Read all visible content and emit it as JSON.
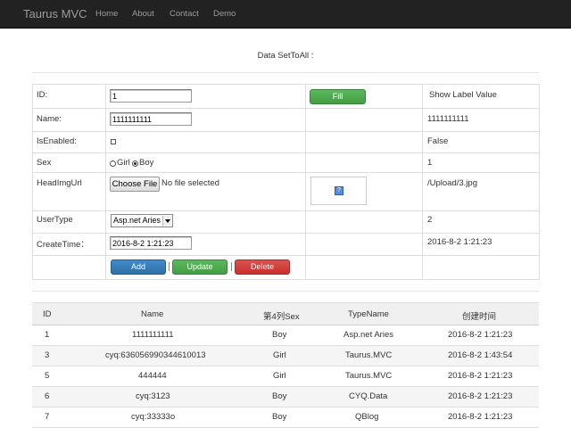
{
  "navbar": {
    "brand": "Taurus MVC",
    "links": [
      "Home",
      "About",
      "Contact",
      "Demo"
    ]
  },
  "form": {
    "title": "Data SetToAll :",
    "header_label": "Show Label Value",
    "fill_button": "Fill",
    "rows": {
      "id": {
        "label": "ID:",
        "input": "1"
      },
      "name": {
        "label": "Name:",
        "input": "1111111111",
        "value": "1111111111"
      },
      "enabled": {
        "label": "IsEnabled:",
        "value": "False"
      },
      "sex": {
        "label": "Sex",
        "option_girl": "Girl",
        "option_boy": "Boy",
        "value": "1"
      },
      "headimg": {
        "label": "HeadImgUrl",
        "file_button": "Choose File",
        "file_status": "No file selected",
        "value": "/Upload/3.jpg"
      },
      "usertype": {
        "label": "UserType",
        "selected": "Asp.net Aries",
        "value": "2"
      },
      "createtime": {
        "label": "CreateTime：",
        "input": "2016-8-2 1:21:23",
        "value": "2016-8-2 1:21:23"
      }
    },
    "actions": {
      "add": "Add",
      "update": "Update",
      "delete": "Delete"
    }
  },
  "table": {
    "headers": [
      "ID",
      "Name",
      "第4列Sex",
      "TypeName",
      "创建时间"
    ],
    "rows": [
      [
        "1",
        "1111111111",
        "Boy",
        "Asp.net Aries",
        "2016-8-2 1:21:23"
      ],
      [
        "3",
        "cyq:636056990344610013",
        "Girl",
        "Taurus.MVC",
        "2016-8-2 1:43:54"
      ],
      [
        "5",
        "444444",
        "Girl",
        "Taurus.MVC",
        "2016-8-2 1:21:23"
      ],
      [
        "6",
        "cyq:3123",
        "Boy",
        "CYQ.Data",
        "2016-8-2 1:21:23"
      ],
      [
        "7",
        "cyq:33333o",
        "Boy",
        "QBlog",
        "2016-8-2 1:21:23"
      ]
    ]
  }
}
